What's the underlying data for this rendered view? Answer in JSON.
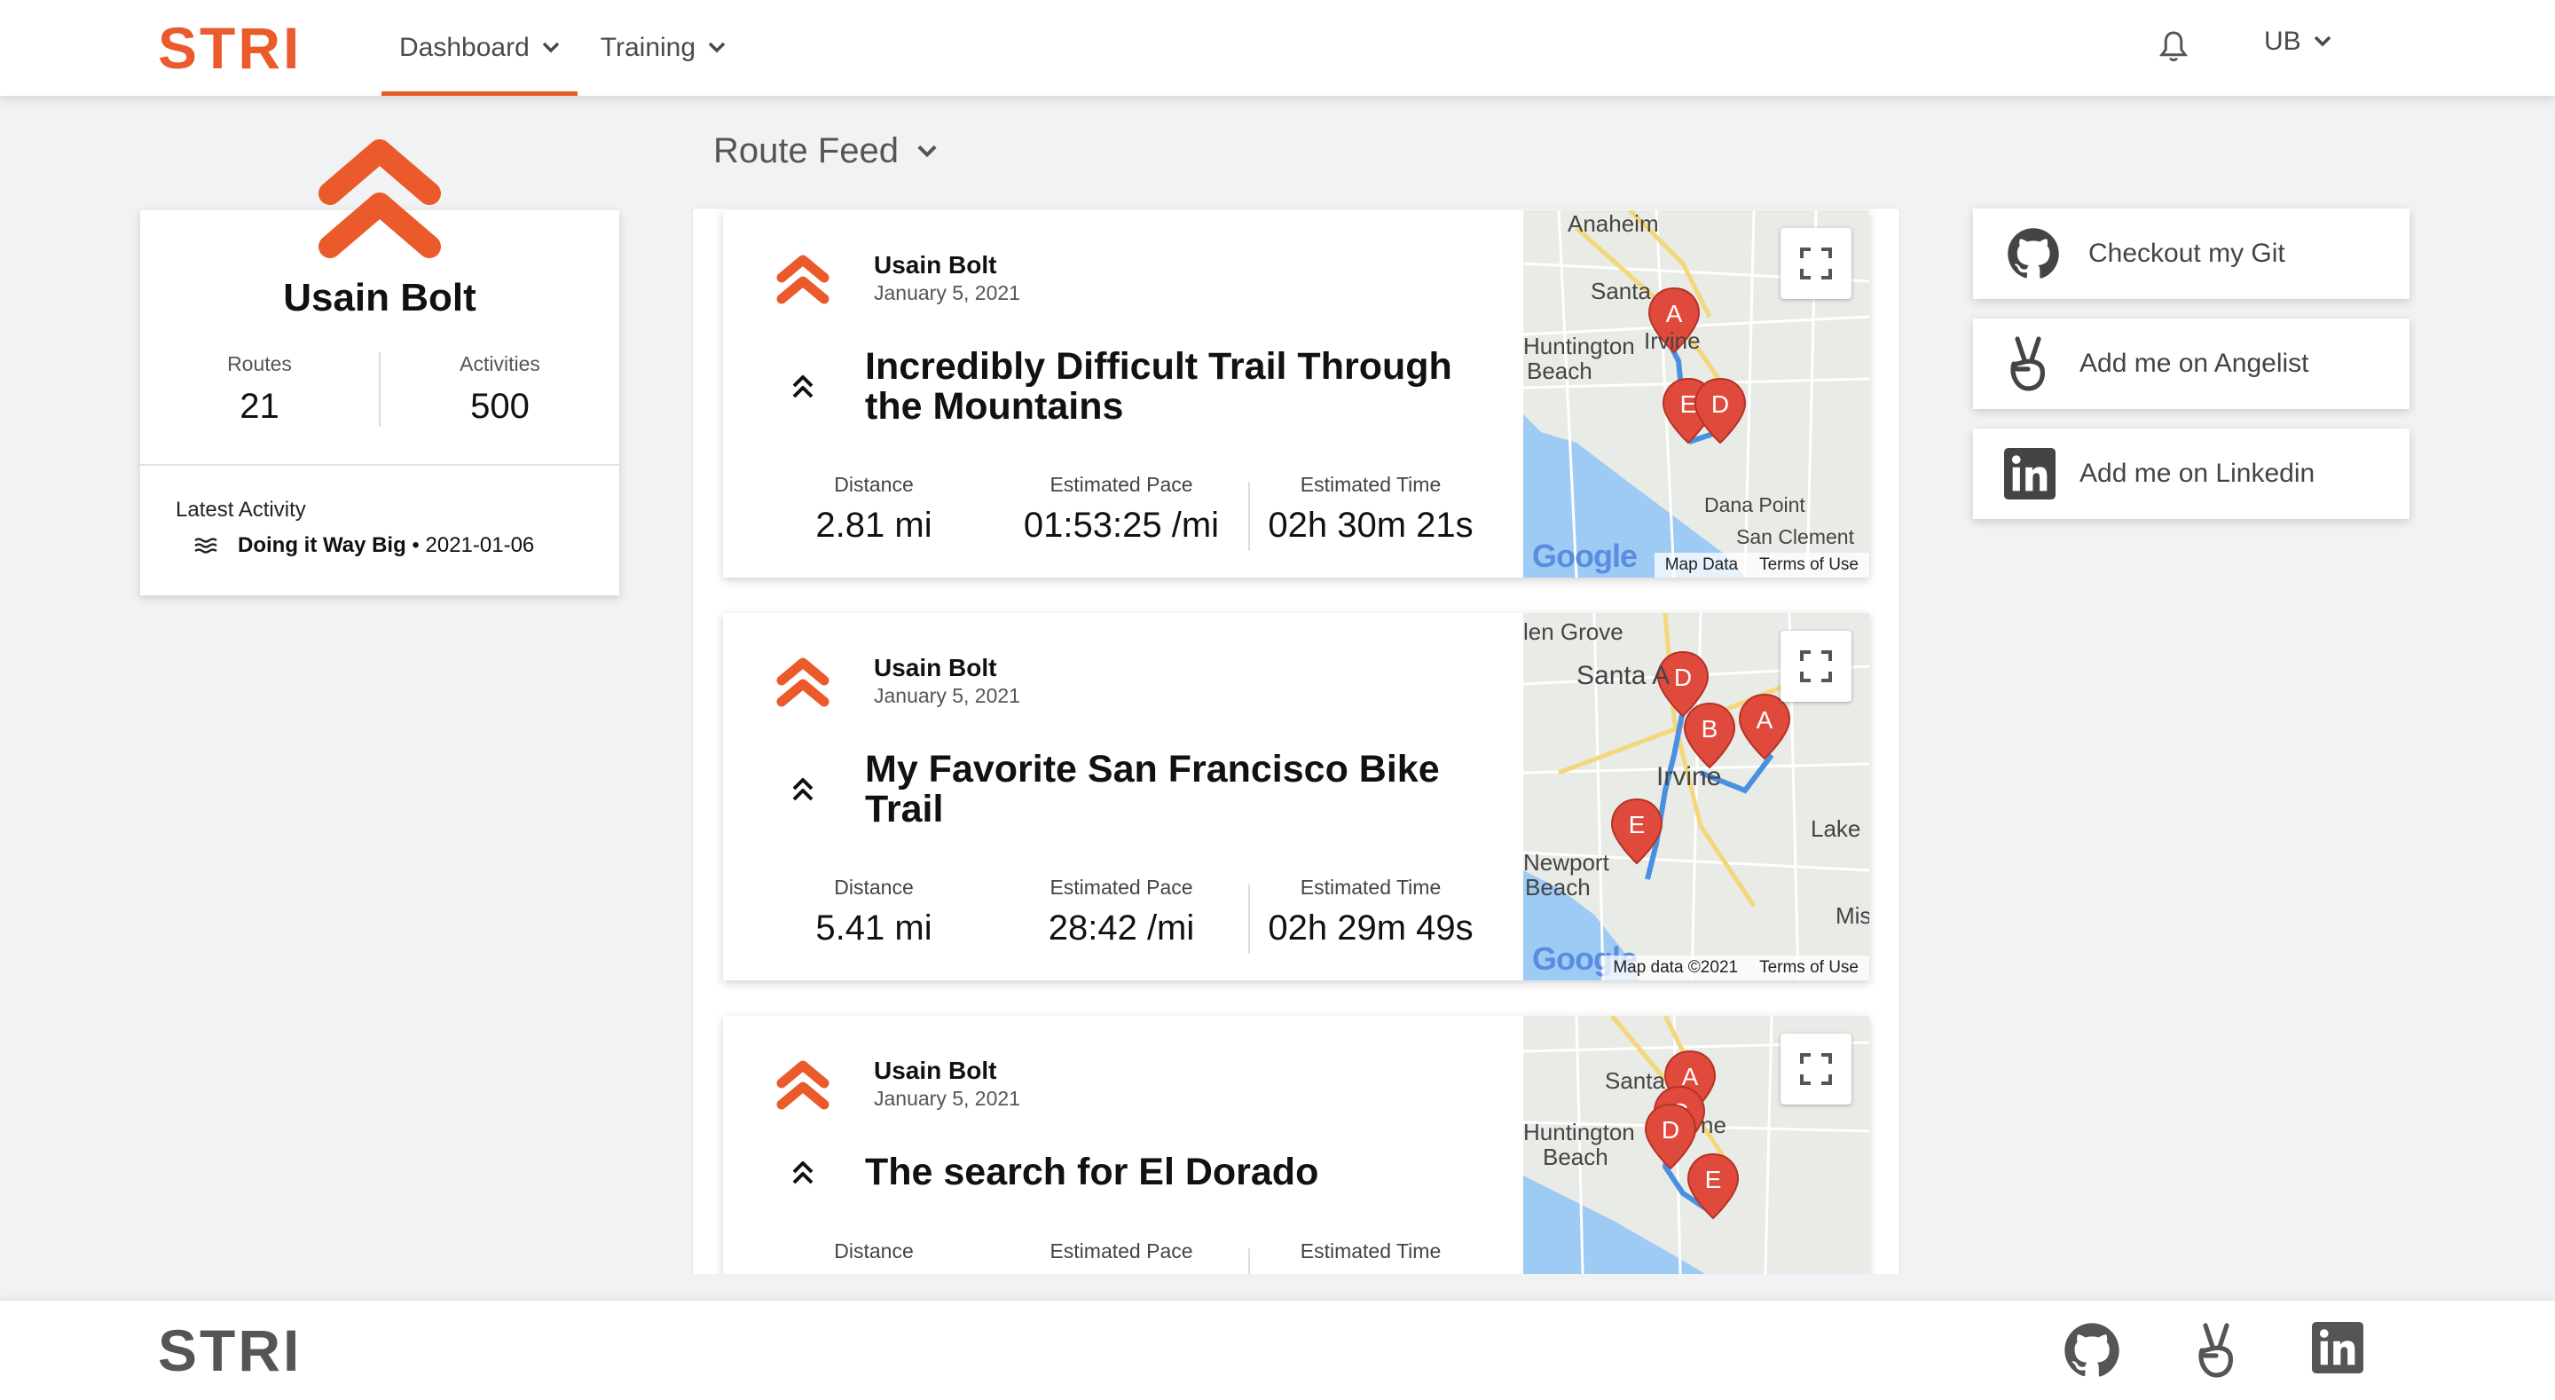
{
  "app": {
    "brand": "STRI",
    "accent_color": "#ea5a2b"
  },
  "nav": {
    "items": [
      {
        "label": "Dashboard",
        "active": true
      },
      {
        "label": "Training",
        "active": false
      }
    ],
    "notification_icon": "bell-icon",
    "user_initials": "UB"
  },
  "profile": {
    "name": "Usain Bolt",
    "routes_label": "Routes",
    "routes_value": "21",
    "activities_label": "Activities",
    "activities_value": "500",
    "latest_activity_label": "Latest Activity",
    "latest_activity_name": "Doing it Way Big",
    "latest_activity_separator": " • ",
    "latest_activity_date": "2021-01-06"
  },
  "feed": {
    "title": "Route Feed",
    "stat_labels": {
      "distance": "Distance",
      "pace": "Estimated Pace",
      "time": "Estimated Time"
    },
    "routes": [
      {
        "author": "Usain Bolt",
        "date": "January 5, 2021",
        "title_line1": "Incredibly Difficult Trail Through",
        "title_line2": "the Mountains",
        "distance": "2.81 mi",
        "pace": "01:53:25 /mi",
        "time": "02h 30m 21s",
        "map": {
          "labels": [
            "Anaheim",
            "Santa",
            "Irvine",
            "Huntington",
            "Beach",
            "Dana Point",
            "San Clement"
          ],
          "markers": [
            "A",
            "E",
            "D"
          ],
          "footer_links": [
            "Map Data",
            "Terms of Use"
          ]
        }
      },
      {
        "author": "Usain Bolt",
        "date": "January 5, 2021",
        "title_line1": "My Favorite San Francisco Bike",
        "title_line2": "Trail",
        "distance": "5.41 mi",
        "pace": "28:42 /mi",
        "time": "02h 29m 49s",
        "map": {
          "labels": [
            "len Grove",
            "Santa A",
            "Irvine",
            "Lake",
            "Newport",
            "Beach",
            "Mis"
          ],
          "markers": [
            "D",
            "B",
            "A",
            "E"
          ],
          "footer_links": [
            "Map data ©2021",
            "Terms of Use"
          ]
        }
      },
      {
        "author": "Usain Bolt",
        "date": "January 5, 2021",
        "title_line1": "The search for El Dorado",
        "title_line2": "",
        "distance": "",
        "pace": "",
        "time": "",
        "map": {
          "labels": [
            "Santa",
            "ne",
            "Huntington",
            "Beach"
          ],
          "markers": [
            "A",
            "C",
            "D",
            "E"
          ],
          "footer_links": []
        }
      }
    ]
  },
  "social": [
    {
      "label": "Checkout my Git",
      "icon": "github-icon"
    },
    {
      "label": "Add me on Angelist",
      "icon": "angellist-icon"
    },
    {
      "label": "Add me on Linkedin",
      "icon": "linkedin-icon"
    }
  ],
  "footer": {
    "brand": "STRI",
    "icons": [
      "github-icon",
      "angellist-icon",
      "linkedin-icon"
    ]
  },
  "map_brand": "Google"
}
